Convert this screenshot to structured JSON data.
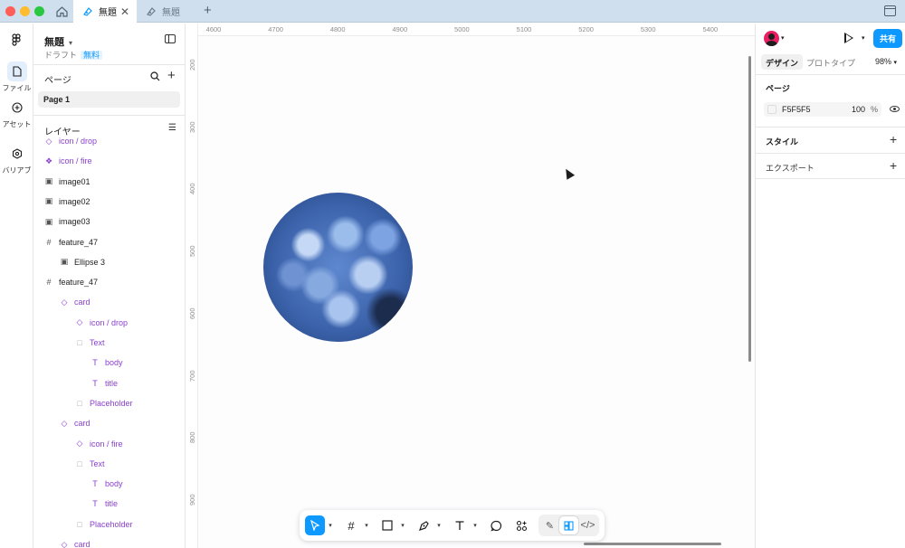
{
  "tabs": [
    {
      "label": "無題",
      "active": true
    },
    {
      "label": "無題",
      "active": false
    }
  ],
  "rail": {
    "items": [
      {
        "label": "ファイル",
        "icon": "file-icon"
      },
      {
        "label": "アセット",
        "icon": "assets-icon"
      },
      {
        "label": "バリアブ",
        "icon": "variables-icon"
      }
    ]
  },
  "file": {
    "title": "無題",
    "subtitle": "ドラフト",
    "badge": "無料"
  },
  "pages": {
    "title": "ページ",
    "items": [
      "Page 1"
    ]
  },
  "layers": {
    "title": "レイヤー",
    "items": [
      {
        "label": "icon / drop",
        "icon": "component-instance-icon",
        "indent": 0,
        "color": "purple"
      },
      {
        "label": "icon / fire",
        "icon": "component-icon",
        "indent": 0,
        "color": "purple"
      },
      {
        "label": "image01",
        "icon": "image-icon",
        "indent": 0,
        "color": "default"
      },
      {
        "label": "image02",
        "icon": "image-icon",
        "indent": 0,
        "color": "default"
      },
      {
        "label": "image03",
        "icon": "image-icon",
        "indent": 0,
        "color": "default"
      },
      {
        "label": "feature_47",
        "icon": "frame-icon",
        "indent": 0,
        "color": "default"
      },
      {
        "label": "Ellipse 3",
        "icon": "image-icon",
        "indent": 1,
        "color": "default"
      },
      {
        "label": "feature_47",
        "icon": "frame-icon",
        "indent": 0,
        "color": "default"
      },
      {
        "label": "card",
        "icon": "instance-icon",
        "indent": 1,
        "color": "purple"
      },
      {
        "label": "icon / drop",
        "icon": "instance-icon",
        "indent": 2,
        "color": "purple"
      },
      {
        "label": "Text",
        "icon": "box-icon",
        "indent": 2,
        "color": "purple"
      },
      {
        "label": "body",
        "icon": "text-icon",
        "indent": 3,
        "color": "purple"
      },
      {
        "label": "title",
        "icon": "text-icon",
        "indent": 3,
        "color": "purple"
      },
      {
        "label": "Placeholder",
        "icon": "box-icon",
        "indent": 2,
        "color": "purple"
      },
      {
        "label": "card",
        "icon": "instance-icon",
        "indent": 1,
        "color": "purple"
      },
      {
        "label": "icon / fire",
        "icon": "instance-icon",
        "indent": 2,
        "color": "purple"
      },
      {
        "label": "Text",
        "icon": "box-icon",
        "indent": 2,
        "color": "purple"
      },
      {
        "label": "body",
        "icon": "text-icon",
        "indent": 3,
        "color": "purple"
      },
      {
        "label": "title",
        "icon": "text-icon",
        "indent": 3,
        "color": "purple"
      },
      {
        "label": "Placeholder",
        "icon": "box-icon",
        "indent": 2,
        "color": "purple"
      },
      {
        "label": "card",
        "icon": "instance-icon",
        "indent": 1,
        "color": "purple"
      }
    ]
  },
  "ruler": {
    "top": [
      "4600",
      "4700",
      "4800",
      "4900",
      "5000",
      "5100",
      "5200",
      "5300",
      "5400"
    ],
    "left": [
      "200",
      "300",
      "400",
      "500",
      "600",
      "700",
      "800",
      "900"
    ]
  },
  "right_panel": {
    "share_label": "共有",
    "tabs": [
      "デザイン",
      "プロトタイプ"
    ],
    "zoom": "98%",
    "page_section": "ページ",
    "page_color": "F5F5F5",
    "page_opacity": "100",
    "percent": "%",
    "style_section": "スタイル",
    "export_section": "エクスポート"
  },
  "help_label": "?",
  "colors": {
    "accent": "#0d99ff",
    "component": "#8a3fcf",
    "titlebar": "#cfdfee"
  }
}
